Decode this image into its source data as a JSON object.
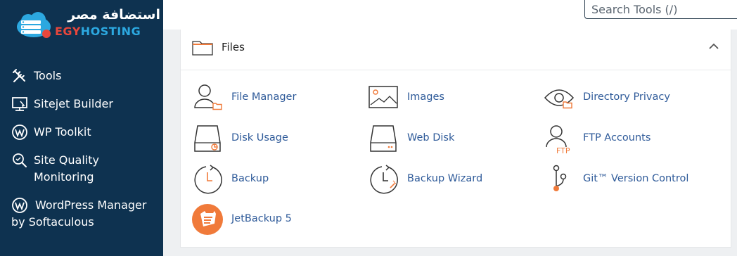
{
  "brand": {
    "arabic_name": "استضافة مصر",
    "english_part1": "EGY",
    "english_part2": "HOSTING"
  },
  "sidebar": {
    "items": [
      {
        "label": "Tools",
        "icon": "tools-icon"
      },
      {
        "label": "Sitejet Builder",
        "icon": "sitejet-icon"
      },
      {
        "label": "WP Toolkit",
        "icon": "wordpress-icon"
      },
      {
        "label": "Site Quality Monitoring",
        "icon": "magnifier-icon"
      },
      {
        "label": "WordPress Manager by Softaculous",
        "icon": "wordpress-icon"
      }
    ]
  },
  "search": {
    "placeholder": "Search Tools (/)"
  },
  "panel": {
    "title": "Files",
    "tools": [
      {
        "label": "File Manager",
        "icon": "file-manager-icon"
      },
      {
        "label": "Images",
        "icon": "images-icon"
      },
      {
        "label": "Directory Privacy",
        "icon": "directory-privacy-icon"
      },
      {
        "label": "Disk Usage",
        "icon": "disk-usage-icon"
      },
      {
        "label": "Web Disk",
        "icon": "web-disk-icon"
      },
      {
        "label": "FTP Accounts",
        "icon": "ftp-accounts-icon"
      },
      {
        "label": "Backup",
        "icon": "backup-icon"
      },
      {
        "label": "Backup Wizard",
        "icon": "backup-wizard-icon"
      },
      {
        "label": "Git™ Version Control",
        "icon": "git-icon"
      },
      {
        "label": "JetBackup 5",
        "icon": "jetbackup-icon"
      }
    ],
    "ftp_icon_text": "FTP"
  },
  "colors": {
    "sidebar_bg": "#0e3250",
    "accent_orange": "#f07a3a",
    "link_blue": "#2e5a99"
  }
}
